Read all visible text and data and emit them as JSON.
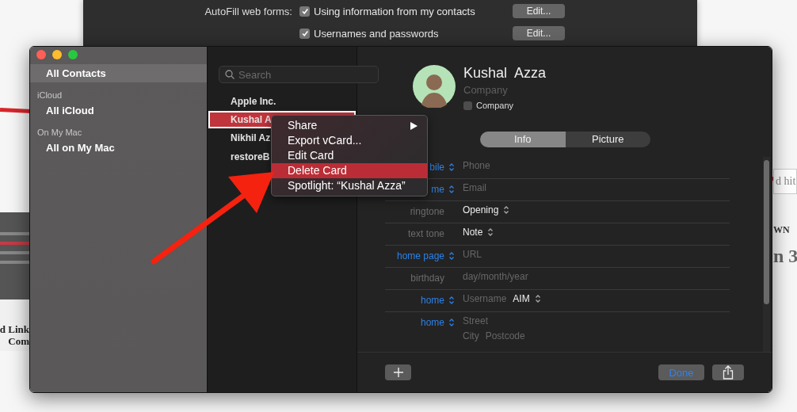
{
  "background_page": {
    "right_texts": [
      {
        "text": "d hit",
        "kind": "field"
      },
      {
        "text": "WN",
        "kind": "caps"
      },
      {
        "text": "n 3",
        "kind": "heading"
      }
    ],
    "left_texts": [
      {
        "text": "d Link",
        "kind": "heading"
      },
      {
        "text": "Com",
        "kind": "heading"
      }
    ]
  },
  "prefs_window": {
    "rows": [
      {
        "label": "AutoFill web forms:",
        "option": "Using information from my contacts",
        "checked": true,
        "button": "Edit..."
      },
      {
        "option": "Usernames and passwords",
        "checked": true,
        "button": "Edit..."
      }
    ]
  },
  "contacts_window": {
    "sidebar": {
      "items": [
        {
          "kind": "item",
          "label": "All Contacts",
          "selected": true
        },
        {
          "kind": "header",
          "label": "iCloud"
        },
        {
          "kind": "item",
          "label": "All iCloud",
          "selected": false
        },
        {
          "kind": "header",
          "label": "On My Mac"
        },
        {
          "kind": "item",
          "label": "All on My Mac",
          "selected": false
        }
      ]
    },
    "search": {
      "placeholder": "Search"
    },
    "contacts": [
      {
        "name": "Apple Inc.",
        "selected": false
      },
      {
        "name": "Kushal A",
        "selected": true
      },
      {
        "name": "Nikhil Az",
        "selected": false
      },
      {
        "name": "restoreB",
        "selected": false
      }
    ],
    "card": {
      "name": "Kushal  Azza",
      "company_placeholder": "Company",
      "company_checkbox": {
        "label": "Company",
        "checked": false
      },
      "tabs": [
        {
          "label": "Info",
          "selected": true
        },
        {
          "label": "Picture",
          "selected": false
        }
      ],
      "fields": [
        {
          "label": "bile",
          "label_popup": true,
          "lines": [
            [
              {
                "text": "Phone",
                "kind": "placeholder"
              }
            ]
          ]
        },
        {
          "label": "me",
          "label_popup": true,
          "lines": [
            [
              {
                "text": "Email",
                "kind": "placeholder"
              }
            ]
          ]
        },
        {
          "label": "ringtone",
          "label_popup": false,
          "lines": [
            [
              {
                "text": "Opening",
                "kind": "popup"
              }
            ]
          ]
        },
        {
          "label": "text tone",
          "label_popup": false,
          "lines": [
            [
              {
                "text": "Note",
                "kind": "popup"
              }
            ]
          ]
        },
        {
          "label": "home page",
          "label_popup": true,
          "lines": [
            [
              {
                "text": "URL",
                "kind": "placeholder"
              }
            ]
          ]
        },
        {
          "label": "birthday",
          "label_popup": false,
          "lines": [
            [
              {
                "text": "day/month/year",
                "kind": "placeholder"
              }
            ]
          ]
        },
        {
          "label": "home",
          "label_popup": true,
          "lines": [
            [
              {
                "text": "Username",
                "kind": "placeholder"
              },
              {
                "text": "AIM",
                "kind": "popup"
              }
            ]
          ]
        },
        {
          "label": "home",
          "label_popup": true,
          "lines": [
            [
              {
                "text": "Street",
                "kind": "placeholder"
              }
            ],
            [
              {
                "text": "City",
                "kind": "placeholder"
              },
              {
                "text": "Postcode",
                "kind": "placeholder"
              }
            ]
          ]
        }
      ],
      "done_button": "Done"
    },
    "context_menu": {
      "items": [
        {
          "label": "Share",
          "submenu": true,
          "highlighted": false
        },
        {
          "label": "Export vCard...",
          "submenu": false,
          "highlighted": false
        },
        {
          "label": "Edit Card",
          "submenu": false,
          "highlighted": false
        },
        {
          "label": "Delete Card",
          "submenu": false,
          "highlighted": true
        },
        {
          "label": "Spotlight: “Kushal Azza”",
          "submenu": false,
          "highlighted": false
        }
      ]
    }
  }
}
